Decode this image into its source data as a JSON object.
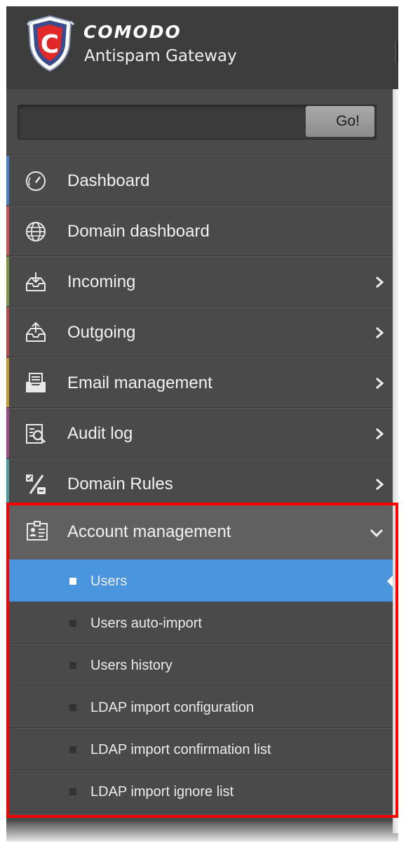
{
  "brand": {
    "name": "COMODO",
    "product": "Antispam Gateway"
  },
  "search": {
    "value": "",
    "button_label": "Go!"
  },
  "menu": [
    {
      "label": "Dashboard",
      "icon": "dashboard-gauge-icon",
      "accent": "#4a7ec8",
      "has_submenu": false
    },
    {
      "label": "Domain dashboard",
      "icon": "globe-icon",
      "accent": "#c8545a",
      "has_submenu": false
    },
    {
      "label": "Incoming",
      "icon": "incoming-tray-icon",
      "accent": "#7a9a48",
      "has_submenu": true
    },
    {
      "label": "Outgoing",
      "icon": "outgoing-tray-icon",
      "accent": "#b44a4a",
      "has_submenu": true
    },
    {
      "label": "Email management",
      "icon": "email-tray-icon",
      "accent": "#c8963a",
      "has_submenu": true
    },
    {
      "label": "Audit log",
      "icon": "audit-log-icon",
      "accent": "#a04a8a",
      "has_submenu": true
    },
    {
      "label": "Domain Rules",
      "icon": "domain-rules-icon",
      "accent": "#4a9a9a",
      "has_submenu": true
    }
  ],
  "account_management": {
    "label": "Account management",
    "icon": "account-card-icon",
    "expanded": true,
    "items": [
      {
        "label": "Users",
        "active": true
      },
      {
        "label": "Users auto-import",
        "active": false
      },
      {
        "label": "Users history",
        "active": false
      },
      {
        "label": "LDAP import configuration",
        "active": false
      },
      {
        "label": "LDAP import confirmation list",
        "active": false
      },
      {
        "label": "LDAP import ignore list",
        "active": false
      }
    ]
  },
  "colors": {
    "sidebar_bg": "#4a4a4a",
    "active_item": "#4b95de",
    "highlight_border": "#ff0000"
  }
}
